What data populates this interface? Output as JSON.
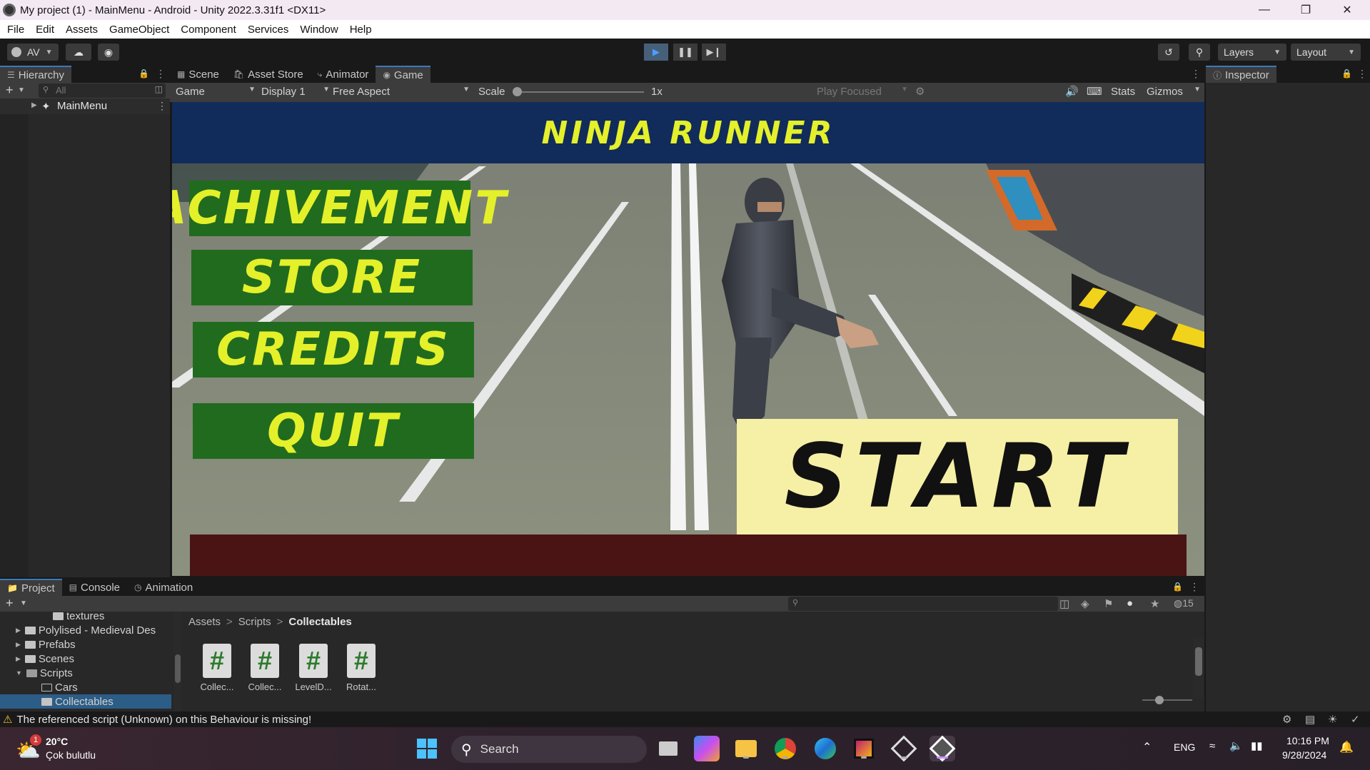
{
  "window": {
    "title": "My project (1) - MainMenu - Android - Unity 2022.3.31f1 <DX11>",
    "controls": [
      "minimize",
      "restore",
      "close"
    ]
  },
  "menubar": [
    "File",
    "Edit",
    "Assets",
    "GameObject",
    "Component",
    "Services",
    "Window",
    "Help"
  ],
  "toolbar": {
    "account": "AV",
    "layers": "Layers",
    "layout": "Layout",
    "play_icons": [
      "play-icon",
      "pause-icon",
      "step-icon"
    ]
  },
  "hierarchy": {
    "tab": "Hierarchy",
    "search_placeholder": "All",
    "items": [
      {
        "label": "MainMenu"
      }
    ]
  },
  "game_tabs": [
    {
      "label": "Scene",
      "icon": "grid-icon"
    },
    {
      "label": "Asset Store",
      "icon": "bag-icon"
    },
    {
      "label": "Animator",
      "icon": "animator-icon"
    },
    {
      "label": "Game",
      "icon": "gamepad-icon",
      "active": true
    }
  ],
  "game_toolbar": {
    "mode": "Game",
    "display": "Display 1",
    "aspect": "Free Aspect",
    "scale_label": "Scale",
    "scale_value": "1x",
    "play_focused": "Play Focused",
    "stats": "Stats",
    "gizmos": "Gizmos"
  },
  "game_view": {
    "title": "NINJA RUNNER",
    "buttons": [
      "ACHIVEMENT",
      "STORE",
      "CREDITS",
      "QUIT"
    ],
    "start": "START"
  },
  "inspector": {
    "tab": "Inspector"
  },
  "bottom_tabs": [
    {
      "label": "Project",
      "icon": "folder-icon",
      "active": true
    },
    {
      "label": "Console",
      "icon": "console-icon"
    },
    {
      "label": "Animation",
      "icon": "clock-icon"
    }
  ],
  "project": {
    "tree": [
      {
        "label": "textures",
        "depth": 3
      },
      {
        "label": "Polylised - Medieval Des",
        "depth": 1
      },
      {
        "label": "Prefabs",
        "depth": 1
      },
      {
        "label": "Scenes",
        "depth": 1
      },
      {
        "label": "Scripts",
        "depth": 1
      },
      {
        "label": "Cars",
        "depth": 2
      },
      {
        "label": "Collectables",
        "depth": 2
      }
    ],
    "breadcrumb": [
      "Assets",
      "Scripts",
      "Collectables"
    ],
    "hidden_count": "15",
    "assets": [
      "Collec...",
      "Collec...",
      "LevelD...",
      "Rotat..."
    ]
  },
  "status": {
    "message": "The referenced script (Unknown) on this Behaviour is missing!"
  },
  "taskbar": {
    "weather_temp": "20°C",
    "weather_desc": "Çok bulutlu",
    "weather_badge": "1",
    "search": "Search",
    "lang": "ENG",
    "time": "10:16 PM",
    "date": "9/28/2024"
  },
  "colors": {
    "accent": "#3a79bb",
    "menu_button_green": "#216b1f",
    "menu_text_yellow": "#e4f02a",
    "start_bg": "#f5f0a6",
    "banner_blue": "#0f2b5c",
    "warning": "#f0c040"
  }
}
